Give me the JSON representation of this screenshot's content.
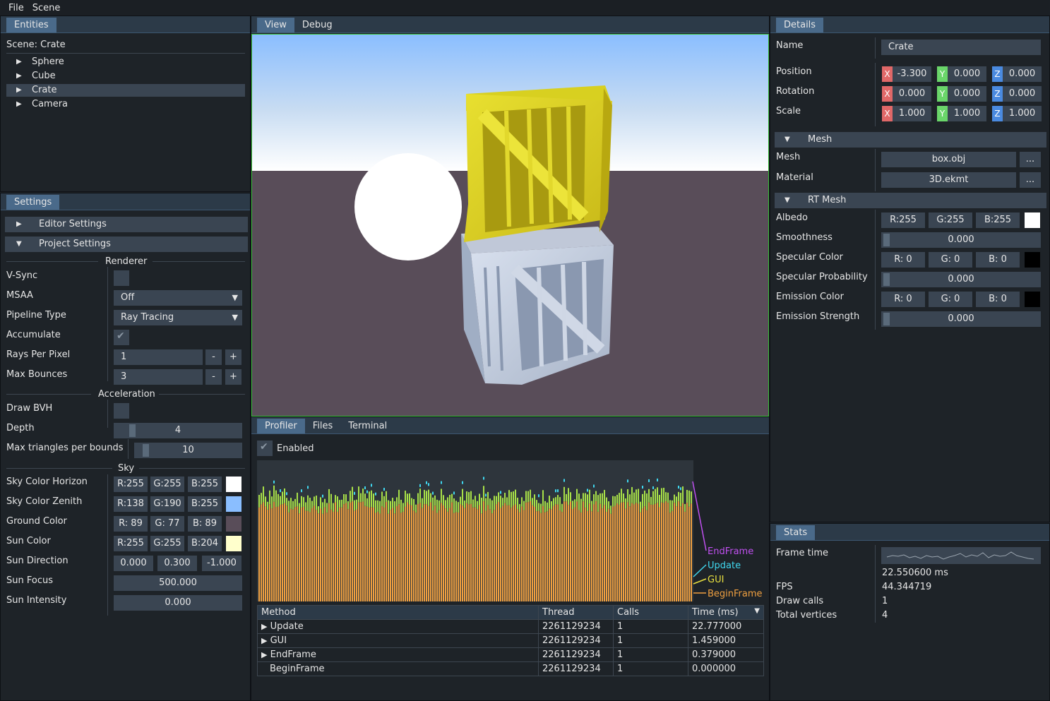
{
  "menu": {
    "file": "File",
    "scene": "Scene"
  },
  "entities": {
    "tab": "Entities",
    "scene_label": "Scene: Crate",
    "items": [
      {
        "label": "Sphere"
      },
      {
        "label": "Cube"
      },
      {
        "label": "Crate"
      },
      {
        "label": "Camera"
      }
    ],
    "selected": "Crate"
  },
  "settings": {
    "tab": "Settings",
    "editor_settings": "Editor Settings",
    "project_settings": "Project Settings",
    "renderer_section": "Renderer",
    "vsync_label": "V-Sync",
    "msaa_label": "MSAA",
    "msaa_value": "Off",
    "pipeline_label": "Pipeline Type",
    "pipeline_value": "Ray Tracing",
    "accumulate_label": "Accumulate",
    "rays_label": "Rays Per Pixel",
    "rays_value": "1",
    "bounces_label": "Max Bounces",
    "bounces_value": "3",
    "minus": "-",
    "plus": "+",
    "accel_section": "Acceleration",
    "drawbvh_label": "Draw BVH",
    "depth_label": "Depth",
    "depth_value": "4",
    "maxtri_label": "Max triangles per bounds",
    "maxtri_value": "10",
    "sky_section": "Sky",
    "sky_horizon_label": "Sky Color Horizon",
    "sky_horizon": {
      "r": "R:255",
      "g": "G:255",
      "b": "B:255",
      "color": "#ffffff"
    },
    "sky_zenith_label": "Sky Color Zenith",
    "sky_zenith": {
      "r": "R:138",
      "g": "G:190",
      "b": "B:255",
      "color": "#8abeff"
    },
    "ground_label": "Ground Color",
    "ground": {
      "r": "R: 89",
      "g": "G: 77",
      "b": "B: 89",
      "color": "#594d59"
    },
    "sun_color_label": "Sun Color",
    "sun_color": {
      "r": "R:255",
      "g": "G:255",
      "b": "B:204",
      "color": "#ffffcc"
    },
    "sun_dir_label": "Sun Direction",
    "sun_dir": {
      "x": "0.000",
      "y": "0.300",
      "z": "-1.000"
    },
    "sun_focus_label": "Sun Focus",
    "sun_focus": "500.000",
    "sun_intensity_label": "Sun Intensity",
    "sun_intensity": "0.000"
  },
  "viewport": {
    "tabs": {
      "view": "View",
      "debug": "Debug"
    }
  },
  "profiler": {
    "tabs": {
      "profiler": "Profiler",
      "files": "Files",
      "terminal": "Terminal"
    },
    "enabled_label": "Enabled",
    "legend": {
      "endframe": "EndFrame",
      "update": "Update",
      "gui": "GUI",
      "beginframe": "BeginFrame"
    },
    "columns": {
      "method": "Method",
      "thread": "Thread",
      "calls": "Calls",
      "time": "Time (ms)"
    },
    "rows": [
      {
        "method": "Update",
        "thread": "2261129234",
        "calls": "1",
        "time": "22.777000"
      },
      {
        "method": "GUI",
        "thread": "2261129234",
        "calls": "1",
        "time": "1.459000"
      },
      {
        "method": "EndFrame",
        "thread": "2261129234",
        "calls": "1",
        "time": "0.379000"
      },
      {
        "method": "BeginFrame",
        "thread": "2261129234",
        "calls": "1",
        "time": "0.000000"
      }
    ],
    "expand_icon": "▶"
  },
  "details": {
    "tab": "Details",
    "name_label": "Name",
    "name_value": "Crate",
    "position_label": "Position",
    "position": {
      "x": "-3.300",
      "y": "0.000",
      "z": "0.000"
    },
    "rotation_label": "Rotation",
    "rotation": {
      "x": "0.000",
      "y": "0.000",
      "z": "0.000"
    },
    "scale_label": "Scale",
    "scale": {
      "x": "1.000",
      "y": "1.000",
      "z": "1.000"
    },
    "axis": {
      "x": "X",
      "y": "Y",
      "z": "Z"
    },
    "mesh_section": "Mesh",
    "mesh_label": "Mesh",
    "mesh_value": "box.obj",
    "material_label": "Material",
    "material_value": "3D.ekmt",
    "browse": "...",
    "rtmesh_section": "RT Mesh",
    "albedo_label": "Albedo",
    "albedo": {
      "r": "R:255",
      "g": "G:255",
      "b": "B:255",
      "color": "#ffffff"
    },
    "smoothness_label": "Smoothness",
    "smoothness": "0.000",
    "spec_color_label": "Specular Color",
    "spec_color": {
      "r": "R: 0",
      "g": "G: 0",
      "b": "B: 0",
      "color": "#000000"
    },
    "spec_prob_label": "Specular Probability",
    "spec_prob": "0.000",
    "emission_color_label": "Emission Color",
    "emission_color": {
      "r": "R: 0",
      "g": "G: 0",
      "b": "B: 0",
      "color": "#000000"
    },
    "emission_strength_label": "Emission Strength",
    "emission_strength": "0.000"
  },
  "stats": {
    "tab": "Stats",
    "frame_time_label": "Frame time",
    "frame_time": "22.550600 ms",
    "fps_label": "FPS",
    "fps": "44.344719",
    "draw_calls_label": "Draw calls",
    "draw_calls": "1",
    "vertices_label": "Total vertices",
    "vertices": "4"
  },
  "colors": {
    "accent": "#4a6a8a",
    "selection": "#3a4552",
    "viewport_border": "#3ac03a",
    "endframe": "#c050f0",
    "update": "#40d8f0",
    "gui": "#e8e040",
    "beginframe": "#f0a040"
  }
}
